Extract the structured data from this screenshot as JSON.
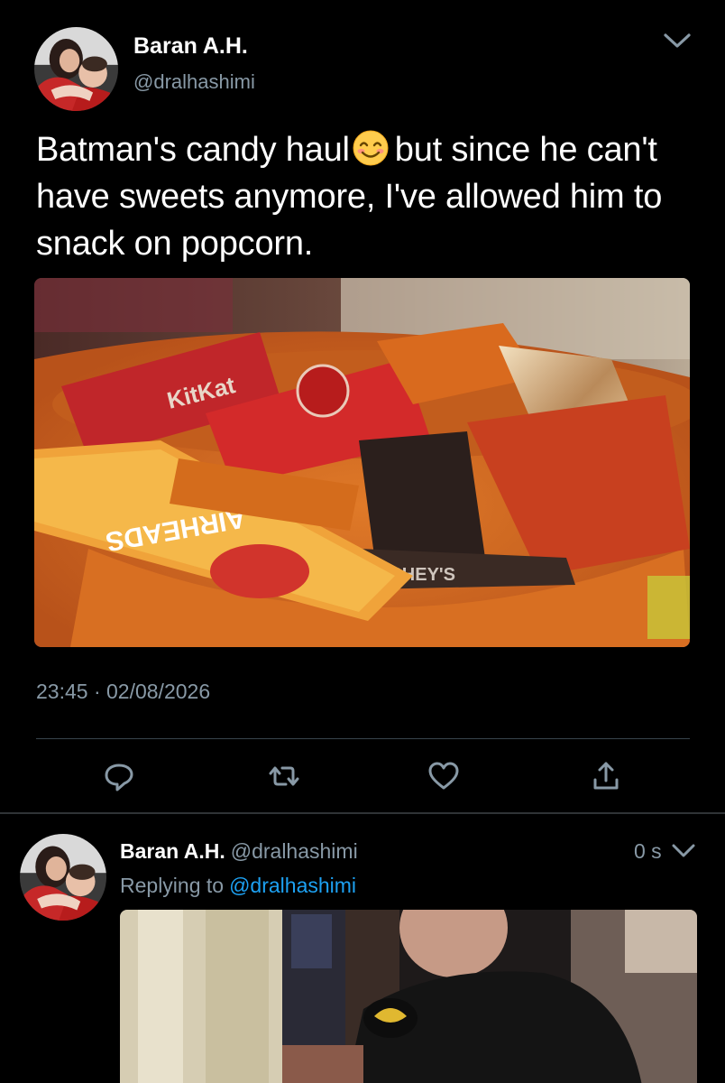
{
  "tweet": {
    "author_name": "Baran A.H.",
    "author_handle": "@dralhashimi",
    "text_before_emoji": "Batman's candy haul",
    "emoji": "smiling-face-emoji",
    "text_after_emoji": "but since he can't have sweets anymore, I've allowed him to snack on popcorn.",
    "timestamp": "23:45 · 02/08/2026",
    "photo": "candy-bowl-photo"
  },
  "actions": {
    "reply_icon": "reply-icon",
    "retweet_icon": "retweet-icon",
    "like_icon": "heart-icon",
    "share_icon": "share-icon"
  },
  "reply_tweet": {
    "author_name": "Baran A.H.",
    "author_handle": "@dralhashimi",
    "time": "0 s",
    "replying_label": "Replying to",
    "replying_target": "@dralhashimi",
    "photo": "batman-child-photo"
  },
  "colors": {
    "background": "#000000",
    "secondary_text": "#8899a6",
    "link": "#1da1f2",
    "divider": "#38444d"
  }
}
